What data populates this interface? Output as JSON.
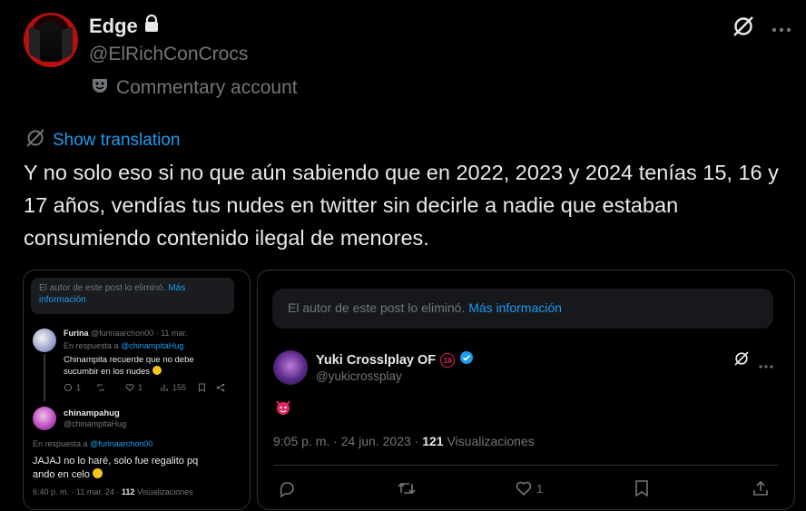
{
  "profile": {
    "name": "Edge",
    "handle": "@ElRichConCrocs",
    "commentary": "Commentary account"
  },
  "translate": {
    "label": "Show translation"
  },
  "post": {
    "text": "Y no solo eso si no que aún sabiendo que en 2022, 2023 y 2024 tenías 15, 16 y 17 años, vendías tus nudes en twitter sin decirle a nadie que estaban consumiendo contenido ilegal de menores."
  },
  "left_card": {
    "deleted_text": "El autor de este post lo eliminó.",
    "deleted_link": "Más información",
    "reply1": {
      "name": "Furina",
      "handle_time": "@furinaarchon00 · 11 mar.",
      "in_reply_prefix": "En respuesta a",
      "in_reply_to": "@chinampitaHug",
      "text_line1": "Chinampita recuerde que no debe",
      "text_line2": "sucumbir en los nudes",
      "replies": "1",
      "likes": "1",
      "views": "155"
    },
    "reply2": {
      "name": "chinampahug",
      "handle": "@chinampitaHug",
      "in_reply_prefix": "En respuesta a",
      "in_reply_to": "@furinaarchon00",
      "text_line1": "JAJAJ no lo haré, solo fue regalito pq",
      "text_line2": "ando en celo",
      "meta": "6:40 p. m. · 11 mar. 24 ·",
      "views_count": "112",
      "views_label": "Visualizaciones"
    }
  },
  "right_card": {
    "deleted_text": "El autor de este post lo eliminó.",
    "deleted_link": "Más información",
    "author_name": "Yuki Crosslplay OF",
    "age_badge": "18",
    "author_handle": "@yukicrossplay",
    "time": "9:05 p. m. · 24 jun. 2023 ·",
    "views_count": "121",
    "views_label": "Visualizaciones",
    "likes": "1"
  },
  "colors": {
    "accent": "#1d9bf0",
    "muted": "#71767b",
    "text": "#e7e9ea"
  }
}
